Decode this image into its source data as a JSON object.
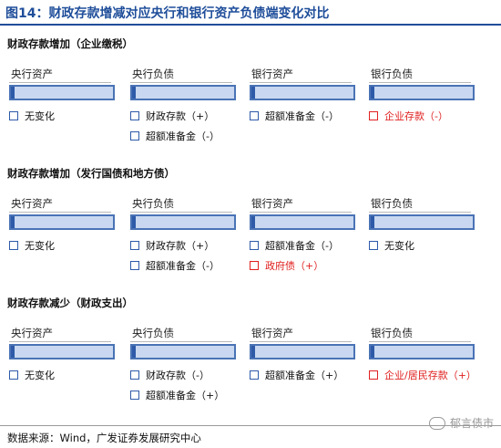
{
  "title": "图14：财政存款增减对应央行和银行资产负债端变化对比",
  "columns": [
    "央行资产",
    "央行负债",
    "银行资产",
    "银行负债"
  ],
  "sections": [
    {
      "title": "财政存款增加（企业缴税）",
      "options": [
        [
          "无变化"
        ],
        [
          "财政存款（+）",
          "超额准备金（-）"
        ],
        [
          "超额准备金（-）"
        ],
        [
          "企业存款（-）"
        ]
      ]
    },
    {
      "title": "财政存款增加（发行国债和地方债）",
      "options": [
        [
          "无变化"
        ],
        [
          "财政存款（+）",
          "超额准备金（-）"
        ],
        [
          "超额准备金（-）",
          "政府债（+）"
        ],
        [
          "无变化"
        ]
      ]
    },
    {
      "title": "财政存款减少（财政支出）",
      "options": [
        [
          "无变化"
        ],
        [
          "财政存款（-）",
          "超额准备金（+）"
        ],
        [
          "超额准备金（+）"
        ],
        [
          "企业/居民存款（+）"
        ]
      ]
    }
  ],
  "highlight_color": "#e02020",
  "bar_color": "#c9d8f0",
  "source": "数据来源：Wind，广发证券发展研究中心",
  "watermark": "郁言债市"
}
